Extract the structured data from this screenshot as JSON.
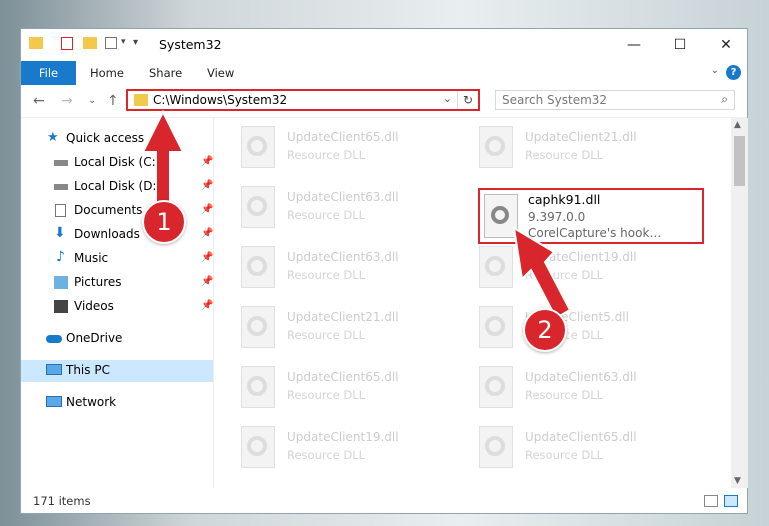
{
  "window": {
    "title": "System32"
  },
  "window_buttons": {
    "minimize": "—",
    "maximize": "☐",
    "close": "✕"
  },
  "ribbon": {
    "file": "File",
    "home": "Home",
    "share": "Share",
    "view": "View",
    "help": "?"
  },
  "address": {
    "path": "C:\\Windows\\System32",
    "refresh": "↻",
    "dropdown": "⌄"
  },
  "search": {
    "placeholder": "Search System32"
  },
  "nav": {
    "back": "←",
    "forward": "→",
    "recent": "⌄",
    "up": "↑"
  },
  "sidebar": {
    "items": [
      {
        "label": "Quick access"
      },
      {
        "label": "Local Disk (C:)"
      },
      {
        "label": "Local Disk (D:)"
      },
      {
        "label": "Documents"
      },
      {
        "label": "Downloads"
      },
      {
        "label": "Music"
      },
      {
        "label": "Pictures"
      },
      {
        "label": "Videos"
      },
      {
        "label": "OneDrive"
      },
      {
        "label": "This PC"
      },
      {
        "label": "Network"
      }
    ]
  },
  "files": [
    {
      "name": "UpdateClient65.dll",
      "type": "Resource DLL"
    },
    {
      "name": "UpdateClient21.dll",
      "type": "Resource DLL"
    },
    {
      "name": "UpdateClient63.dll",
      "type": "Resource DLL"
    },
    {
      "name": "UpdateClient63.dll",
      "type": "Resource DLL"
    },
    {
      "name": "UpdateClient19.dll",
      "type": "Resource DLL"
    },
    {
      "name": "UpdateClient21.dll",
      "type": "Resource DLL"
    },
    {
      "name": "UpdateClient5.dll",
      "type": "Resource DLL"
    },
    {
      "name": "UpdateClient65.dll",
      "type": "Resource DLL"
    },
    {
      "name": "UpdateClient63.dll",
      "type": "Resource DLL"
    },
    {
      "name": "UpdateClient19.dll",
      "type": "Resource DLL"
    },
    {
      "name": "UpdateClient65.dll",
      "type": "Resource DLL"
    }
  ],
  "highlighted_file": {
    "name": "caphk91.dll",
    "version": "9.397.0.0",
    "description": "CorelCapture's hook…"
  },
  "status": {
    "items": "171 items"
  },
  "annotations": {
    "step1": "1",
    "step2": "2"
  },
  "colors": {
    "accent": "#1979ca",
    "highlight": "#d9262c"
  }
}
